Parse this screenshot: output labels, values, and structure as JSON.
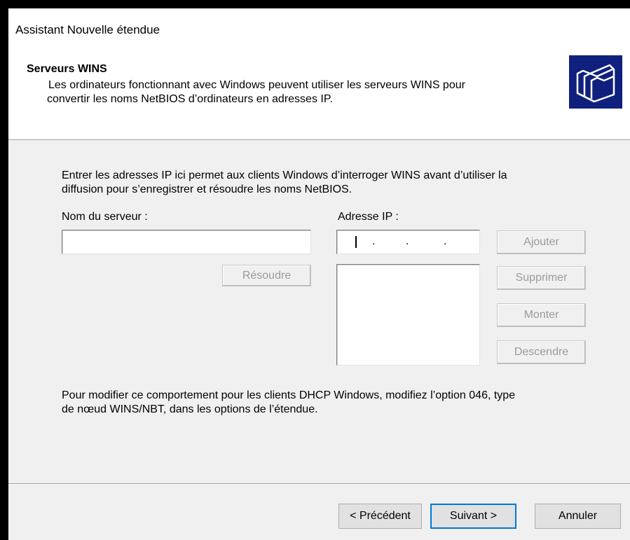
{
  "window": {
    "title": "Assistant Nouvelle étendue"
  },
  "header": {
    "title": "Serveurs WINS",
    "description_line1": "Les ordinateurs fonctionnant avec Windows peuvent utiliser les serveurs WINS pour",
    "description_line2": "convertir les noms NetBIOS d’ordinateurs en adresses IP.",
    "icon": "folders-icon"
  },
  "content": {
    "intro_line1": "Entrer les adresses IP ici permet aux clients Windows d’interroger WINS avant d’utiliser la",
    "intro_line2": "diffusion pour s’enregistrer et résoudre les noms NetBIOS.",
    "server_name_label": "Nom du serveur :",
    "server_name_value": "",
    "ip_label": "Adresse IP :",
    "ip_dots": ".",
    "resolve_button": "Résoudre",
    "add_button": "Ajouter",
    "delete_button": "Supprimer",
    "up_button": "Monter",
    "down_button": "Descendre",
    "ip_list": [],
    "note_line1": "Pour modifier ce comportement pour les clients DHCP Windows, modifiez l’option 046, type",
    "note_line2": "de nœud WINS/NBT, dans les options de l’étendue."
  },
  "footer": {
    "back_button": "< Précédent",
    "next_button": "Suivant >",
    "cancel_button": "Annuler"
  }
}
